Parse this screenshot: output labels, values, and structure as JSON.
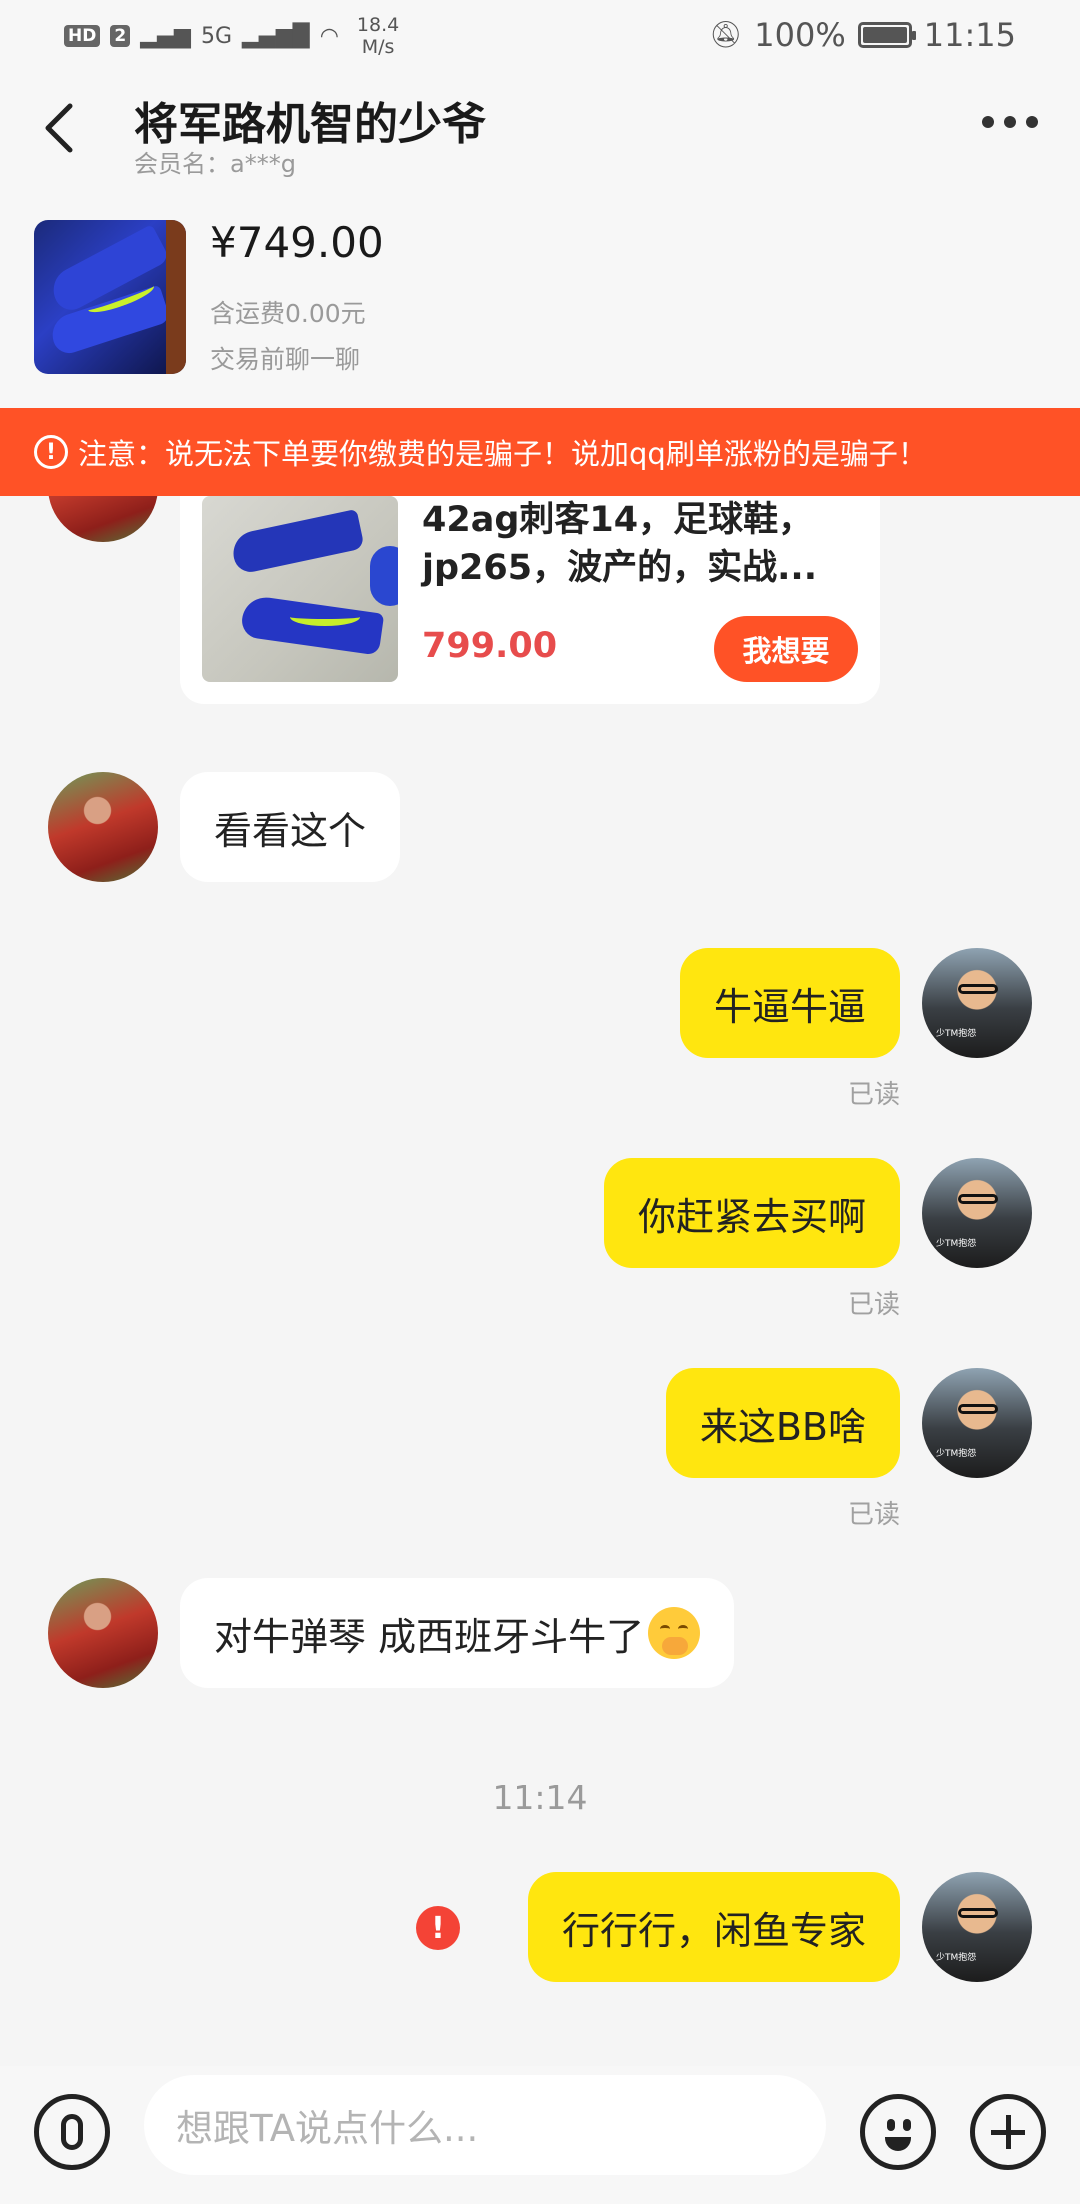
{
  "status_bar": {
    "network_badge": "HD",
    "sim_badge": "2",
    "signal_label": "5G",
    "speed_value": "18.4",
    "speed_unit": "M/s",
    "battery": "100%",
    "time": "11:15"
  },
  "header": {
    "title": "将军路机智的少爷",
    "member_label": "会员名：a***g"
  },
  "product": {
    "price": "¥749.00",
    "shipping": "含运费0.00元",
    "hint": "交易前聊一聊"
  },
  "warning": {
    "text": "注意：说无法下单要你缴费的是骗子！说加qq刷单涨粉的是骗子！"
  },
  "shared_item": {
    "title": "42ag刺客14，足球鞋，jp265，波产的，实战...",
    "price": "799.00",
    "want_button": "我想要"
  },
  "messages": [
    {
      "side": "left",
      "text": "看看这个"
    },
    {
      "side": "right",
      "text": "牛逼牛逼",
      "status": "已读"
    },
    {
      "side": "right",
      "text": "你赶紧去买啊",
      "status": "已读"
    },
    {
      "side": "right",
      "text": "来这BB啥",
      "status": "已读"
    },
    {
      "side": "left",
      "text": "对牛弹琴 成西班牙斗牛了"
    },
    {
      "side": "right",
      "text": "行行行，闲鱼专家",
      "failed": true
    }
  ],
  "timestamp": "11:14",
  "avatar_caption": "少TM抱怨",
  "input": {
    "placeholder": "想跟TA说点什么..."
  },
  "colors": {
    "accent": "#ff5226",
    "bubble_self": "#ffe60f",
    "price_red": "#e74c4c"
  },
  "icons": [
    "back-arrow-icon",
    "more-icon",
    "warning-icon",
    "error-icon",
    "microphone-icon",
    "emoji-icon",
    "plus-icon"
  ]
}
